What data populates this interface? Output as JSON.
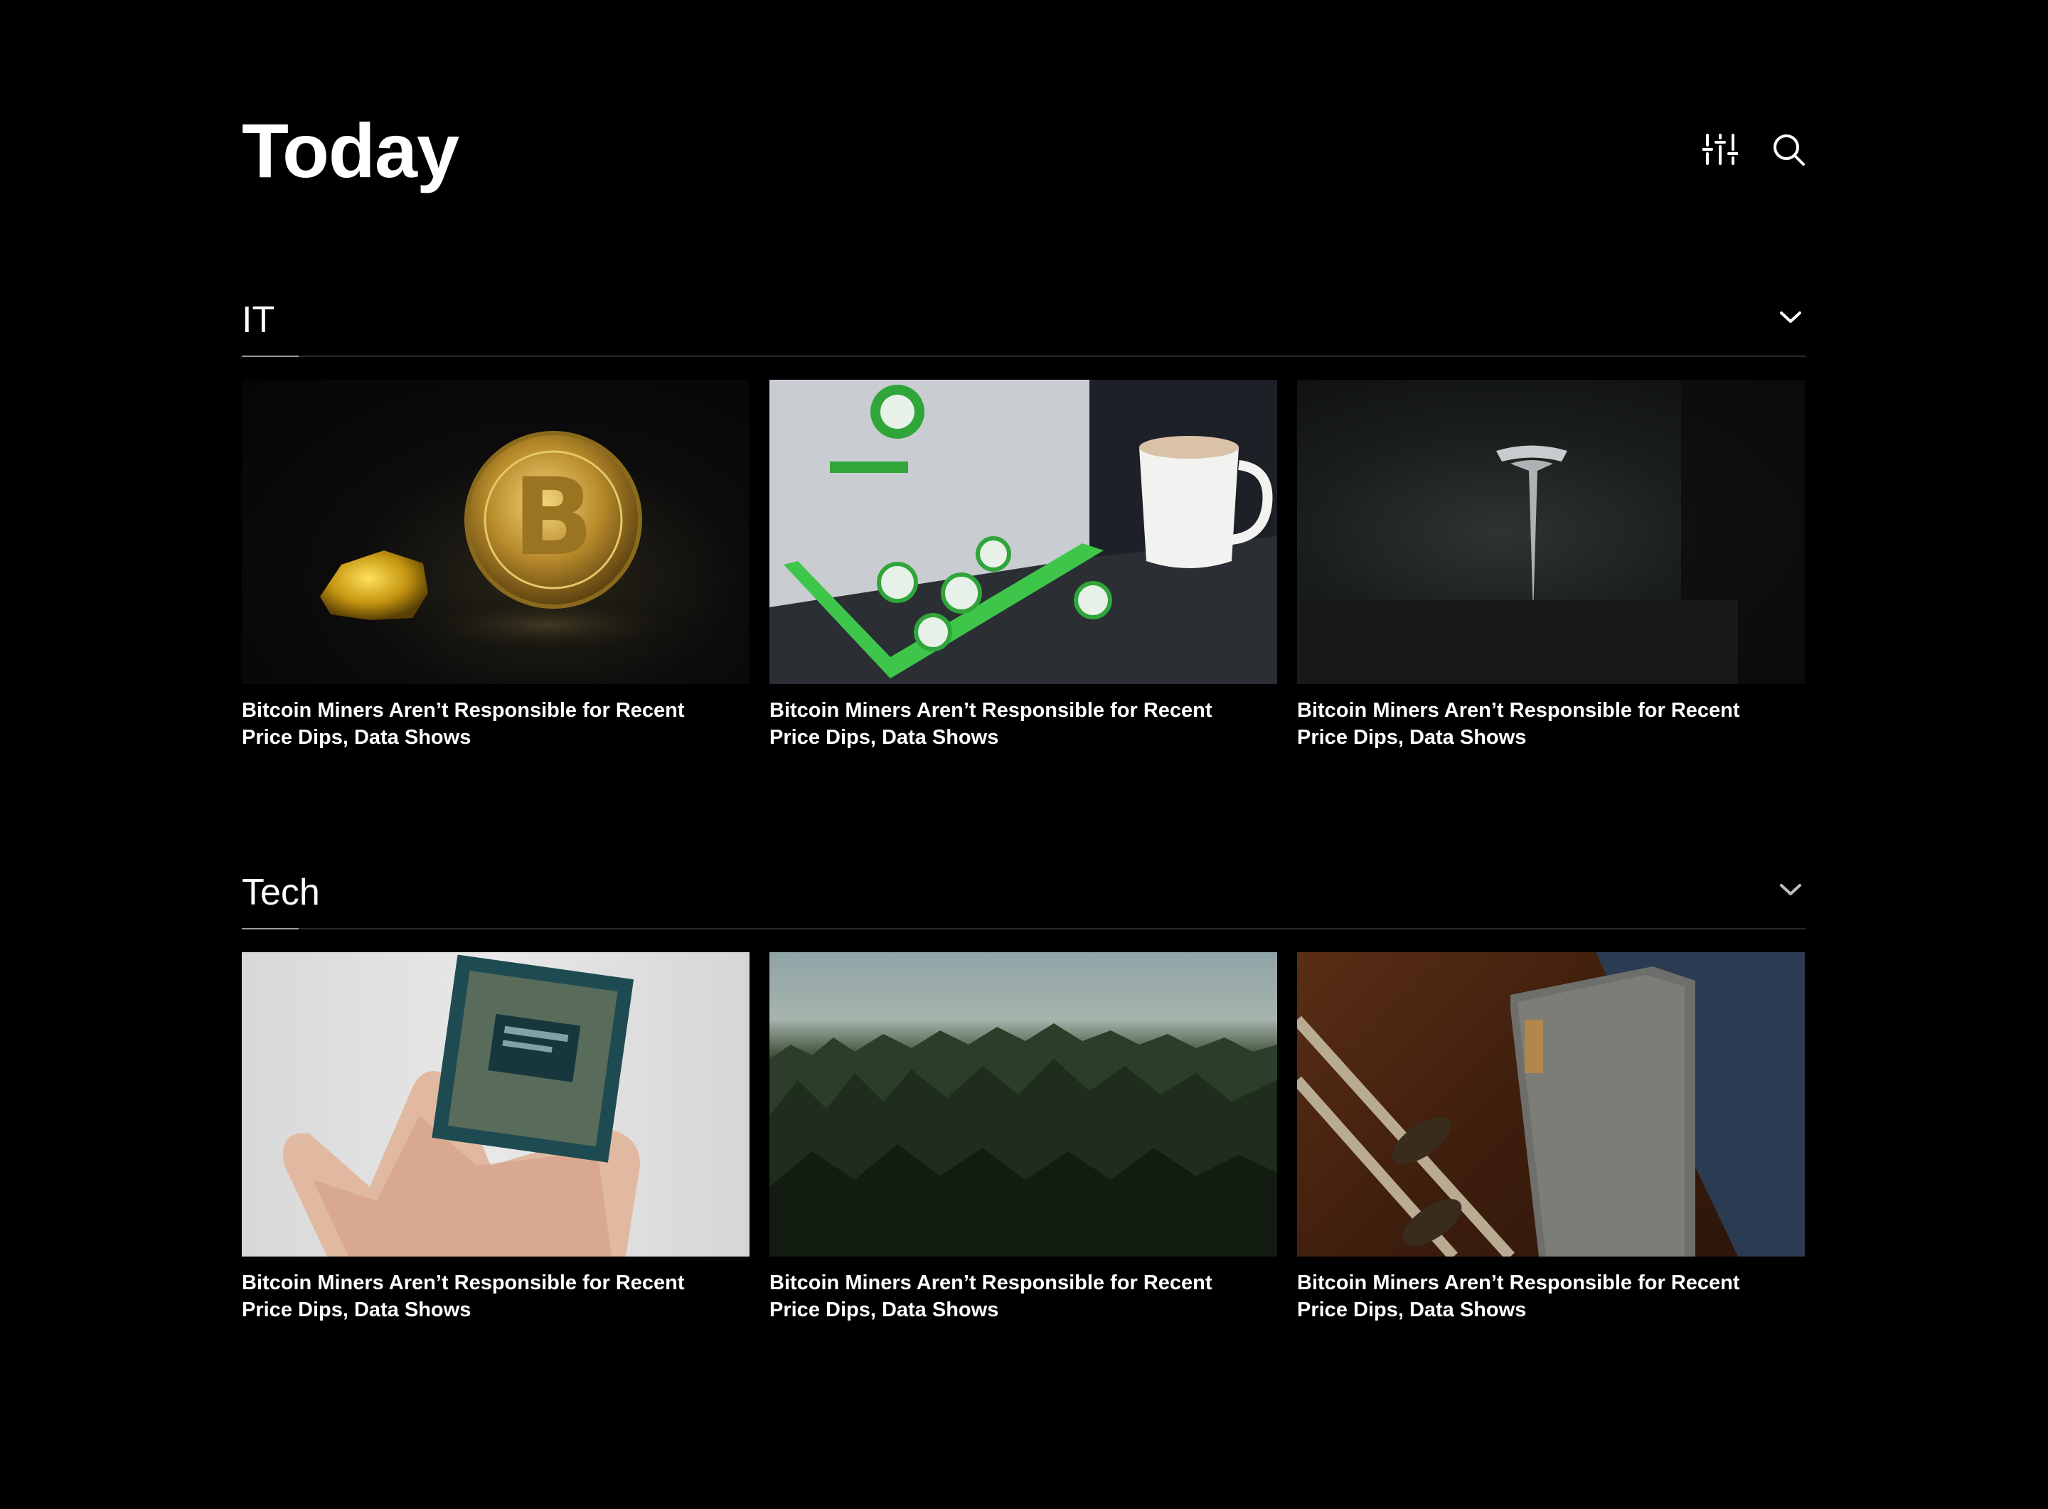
{
  "header": {
    "title": "Today",
    "filter_icon": "sliders-icon",
    "search_icon": "search-icon"
  },
  "sections": [
    {
      "title": "IT",
      "toggle_icon": "chevron-down-icon",
      "cards": [
        {
          "title": "Bitcoin Miners Aren’t Responsible for Recent Price Dips, Data Shows",
          "image": "bitcoin coin and gold nugget"
        },
        {
          "title": "Bitcoin Miners Aren’t Responsible for Recent Price Dips, Data Shows",
          "image": "laptop with green stickers and coffee mug"
        },
        {
          "title": "Bitcoin Miners Aren’t Responsible for Recent Price Dips, Data Shows",
          "image": "tesla logo on dark car surface"
        }
      ]
    },
    {
      "title": "Tech",
      "toggle_icon": "chevron-down-icon",
      "cards": [
        {
          "title": "Bitcoin Miners Aren’t Responsible for Recent Price Dips, Data Shows",
          "image": "hand holding cpu chip"
        },
        {
          "title": "Bitcoin Miners Aren’t Responsible for Recent Price Dips, Data Shows",
          "image": "pine forest under sky"
        },
        {
          "title": "Bitcoin Miners Aren’t Responsible for Recent Price Dips, Data Shows",
          "image": "lenovo laptop on wooden desk"
        }
      ]
    }
  ],
  "colors": {
    "background": "#000000",
    "text": "#ffffff",
    "divider": "#2a2a2a",
    "active_underline": "#9a9a9a"
  }
}
